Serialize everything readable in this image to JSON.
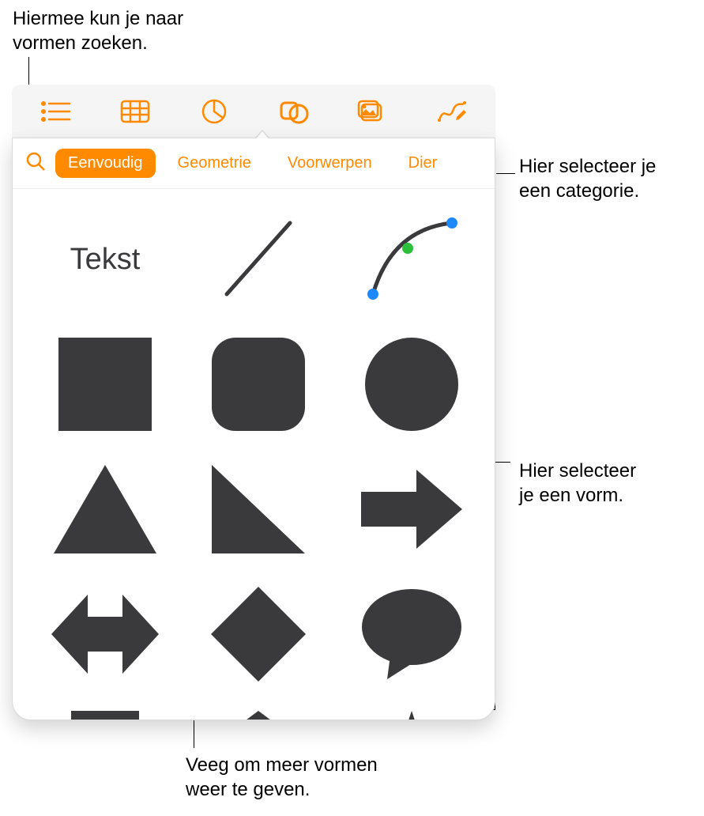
{
  "callouts": {
    "search": "Hiermee kun je naar\nvormen zoeken.",
    "category": "Hier selecteer je\neen categorie.",
    "shape": "Hier selecteer\nje een vorm.",
    "swipe": "Veeg om meer vormen\nweer te geven."
  },
  "toolbar": {
    "items": [
      {
        "name": "list-icon"
      },
      {
        "name": "table-icon"
      },
      {
        "name": "chart-icon"
      },
      {
        "name": "shapes-icon"
      },
      {
        "name": "media-icon"
      },
      {
        "name": "draw-icon"
      }
    ],
    "selected_index": 3
  },
  "categories": {
    "items": [
      "Eenvoudig",
      "Geometrie",
      "Voorwerpen",
      "Dier"
    ],
    "selected_index": 0
  },
  "shapes": {
    "text_label": "Tekst",
    "items": [
      {
        "name": "text-shape"
      },
      {
        "name": "line-shape"
      },
      {
        "name": "curve-shape"
      },
      {
        "name": "square-shape"
      },
      {
        "name": "rounded-square-shape"
      },
      {
        "name": "circle-shape"
      },
      {
        "name": "triangle-shape"
      },
      {
        "name": "right-triangle-shape"
      },
      {
        "name": "arrow-right-shape"
      },
      {
        "name": "arrow-bidir-shape"
      },
      {
        "name": "diamond-shape"
      },
      {
        "name": "speech-bubble-shape"
      },
      {
        "name": "hat-shape"
      },
      {
        "name": "pentagon-shape"
      },
      {
        "name": "star-shape"
      }
    ]
  },
  "colors": {
    "accent": "#ff8a00",
    "shape": "#3a3a3c"
  }
}
